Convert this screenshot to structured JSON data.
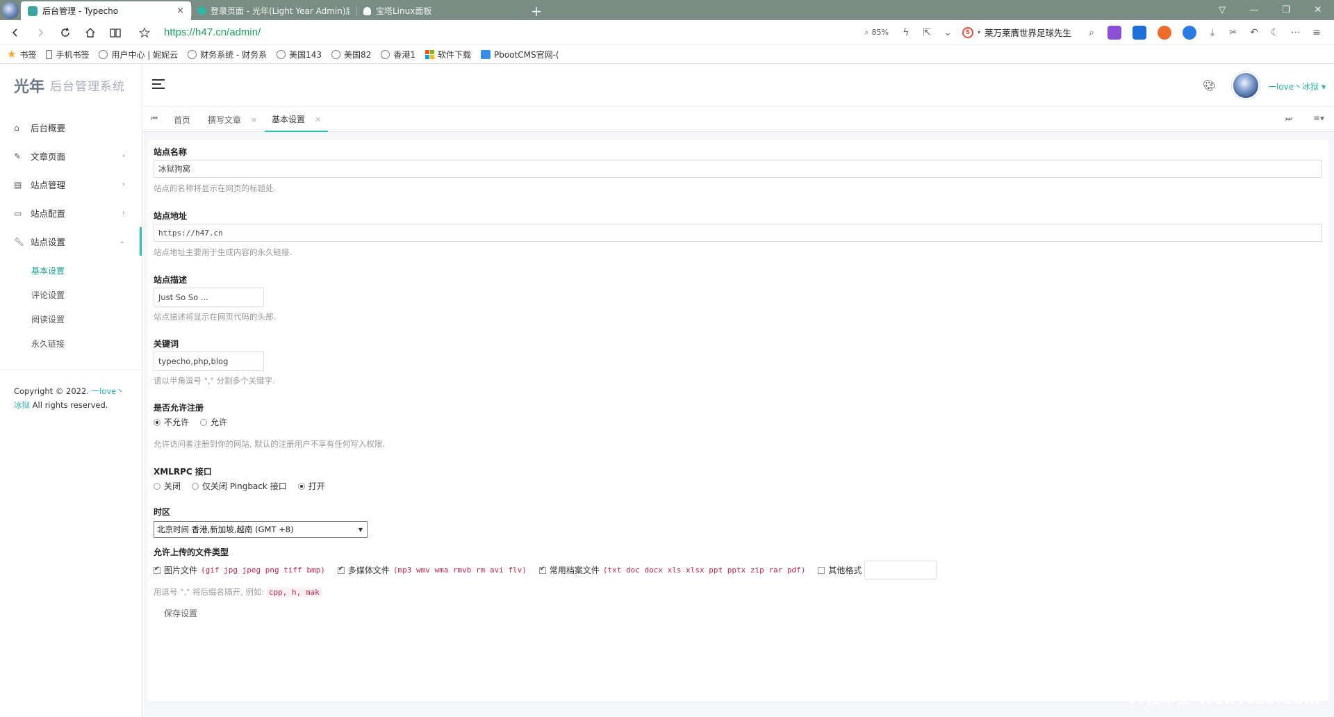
{
  "browser": {
    "tabs": [
      {
        "title": "后台管理 - Typecho",
        "close": "×",
        "color": "#3aa7a0"
      },
      {
        "title": "登录页面 - 光年(Light Year Admin)后",
        "color": "#2bb9a6"
      },
      {
        "title": "宝塔Linux面板",
        "color": "#ffffff"
      }
    ],
    "new_tab": "+",
    "url": "https://h47.cn/admin/",
    "zoom": "85%",
    "news": "莱万莱膺世界足球先生",
    "bookmarks": [
      "书签",
      "手机书签",
      "用户中心 | 妮妮云",
      "财务系统 - 财务系",
      "美国143",
      "美国82",
      "香港1",
      "软件下载",
      "PbootCMS官网-("
    ]
  },
  "app": {
    "logo_mark": "光年",
    "logo_text": "后台管理系统",
    "menu": [
      {
        "label": "后台概要",
        "icon": "home-icon"
      },
      {
        "label": "文章页面",
        "icon": "pencil-icon"
      },
      {
        "label": "站点管理",
        "icon": "table-icon"
      },
      {
        "label": "站点配置",
        "icon": "monitor-icon"
      },
      {
        "label": "站点设置",
        "icon": "wrench-icon"
      }
    ],
    "submenu": [
      "基本设置",
      "评论设置",
      "阅读设置",
      "永久链接"
    ],
    "copyright_prefix": "Copyright © 2022.",
    "copyright_link": "一love丶冰狱",
    "copyright_suffix": "All rights reserved.",
    "user_name": "一love丶冰狱",
    "page_tabs": [
      {
        "label": "首页"
      },
      {
        "label": "撰写文章",
        "close": "×"
      },
      {
        "label": "基本设置",
        "close": "×"
      }
    ]
  },
  "form": {
    "site_name_label": "站点名称",
    "site_name_value": "冰狱狗窝",
    "site_name_help": "站点的名称将显示在网页的标题处.",
    "site_url_label": "站点地址",
    "site_url_value": "https://h47.cn",
    "site_url_help": "站点地址主要用于生成内容的永久链接.",
    "desc_label": "站点描述",
    "desc_value": "Just So So ...",
    "desc_help": "站点描述将显示在网页代码的头部.",
    "kw_label": "关键词",
    "kw_value": "typecho,php,blog",
    "kw_help": "请以半角逗号 \",\" 分割多个关键字.",
    "reg_label": "是否允许注册",
    "reg_opts": [
      "不允许",
      "允许"
    ],
    "reg_help": "允许访问者注册到你的网站, 默认的注册用户不享有任何写入权限.",
    "xml_label": "XMLRPC 接口",
    "xml_opts": [
      "关闭",
      "仅关闭 Pingback 接口",
      "打开"
    ],
    "tz_label": "时区",
    "tz_value": "北京时间 香港,新加坡,越南 (GMT +8)",
    "ft_label": "允许上传的文件类型",
    "ft_opts": [
      {
        "label": "图片文件",
        "exts": "(gif jpg jpeg png tiff bmp)"
      },
      {
        "label": "多媒体文件",
        "exts": "(mp3 wmv wma rmvb rm avi flv)"
      },
      {
        "label": "常用档案文件",
        "exts": "(txt doc docx xls xlsx ppt pptx zip rar pdf)"
      },
      {
        "label": "其他格式"
      }
    ],
    "ft_help": "用逗号 \",\" 将后缀名隔开, 例如:",
    "ft_help_example": "cpp, h, mak",
    "save": "保存设置"
  },
  "watermark": "IT技术文 WenYtao.Com"
}
